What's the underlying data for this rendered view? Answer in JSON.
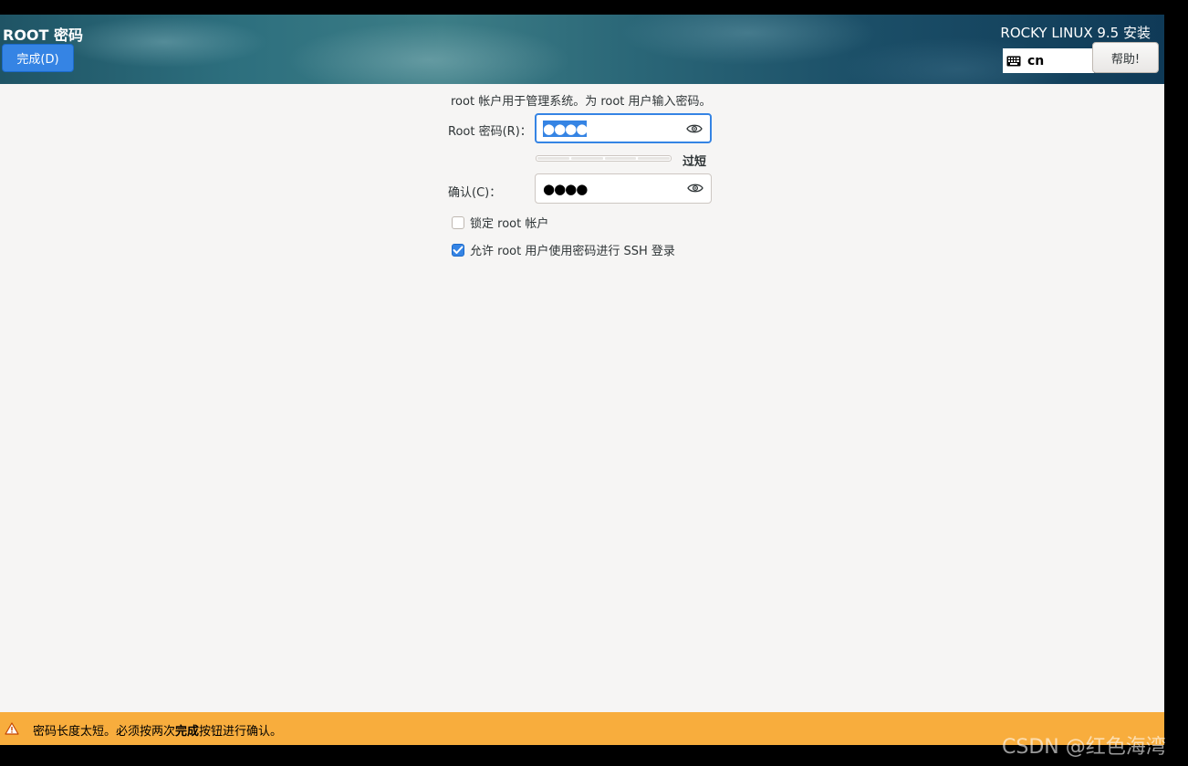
{
  "header": {
    "page_title": "ROOT 密码",
    "done_label": "完成(D)",
    "product_title": "ROCKY LINUX 9.5 安装",
    "keyboard_layout": "cn",
    "help_label": "帮助!"
  },
  "form": {
    "description": "root 帐户用于管理系统。为 root 用户输入密码。",
    "root_password_label": "Root 密码(R)：",
    "root_password_value": "●●●●",
    "strength_label": "过短",
    "strength_level": 0,
    "confirm_label": "确认(C)：",
    "confirm_value": "●●●●",
    "lock_root_label": "锁定 root 帐户",
    "lock_root_checked": false,
    "allow_ssh_label": "允许 root 用户使用密码进行 SSH 登录",
    "allow_ssh_checked": true
  },
  "warning": {
    "text_before": "密码长度太短。必须按两次",
    "text_bold": "完成",
    "text_after": "按钮进行确认。"
  },
  "watermark": "CSDN @红色海湾",
  "icons": {
    "keyboard": "keyboard-icon",
    "eye": "eye-icon",
    "warning": "warning-icon",
    "check": "check-icon"
  },
  "colors": {
    "accent": "#3584e4",
    "warning_bar": "#f8ad3d",
    "background": "#f6f5f4"
  }
}
